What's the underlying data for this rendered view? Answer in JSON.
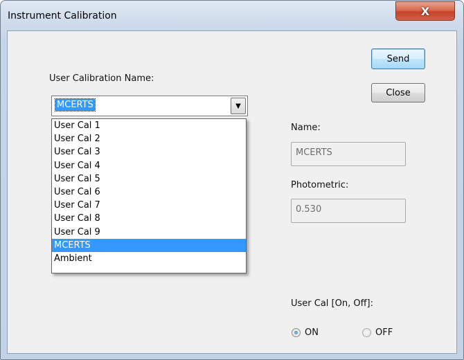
{
  "window": {
    "title": "Instrument Calibration",
    "close_glyph": "X"
  },
  "buttons": {
    "send": "Send",
    "close": "Close"
  },
  "calibration": {
    "label": "User Calibration Name:",
    "selected": "MCERTS",
    "options": [
      "User Cal 1",
      "User Cal 2",
      "User Cal 3",
      "User Cal 4",
      "User Cal 5",
      "User Cal 6",
      "User Cal 7",
      "User Cal 8",
      "User Cal 9",
      "MCERTS",
      "Ambient"
    ],
    "highlighted_index": 9
  },
  "name": {
    "label": "Name:",
    "value": "MCERTS"
  },
  "photometric": {
    "label": "Photometric:",
    "value": "0.530"
  },
  "user_cal": {
    "label": "User Cal [On, Off]:",
    "on_label": "ON",
    "off_label": "OFF",
    "selected": "ON"
  },
  "colors": {
    "selection": "#3399ff",
    "default_button": "#bee6fd"
  }
}
